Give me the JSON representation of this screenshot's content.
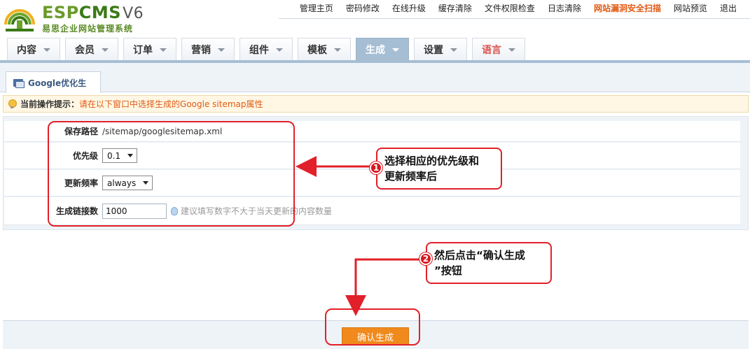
{
  "logo": {
    "brand_prefix": "ESP",
    "brand_suffix": "CMS",
    "version": "V6",
    "subtitle": "易思企业网站管理系统"
  },
  "topnav": [
    "管理主页",
    "密码修改",
    "在线升级",
    "缓存清除",
    "文件权限检查",
    "日志清除",
    "网站漏洞安全扫描",
    "网站预览",
    "退出"
  ],
  "mainnav": [
    "内容",
    "会员",
    "订单",
    "营销",
    "组件",
    "模板",
    "生成",
    "设置",
    "语言"
  ],
  "subtab": "Google优化生",
  "tip": {
    "label": "当前操作提示：",
    "message": "请在以下窗口中选择生成的Google sitemap属性"
  },
  "form": {
    "path_label": "保存路径",
    "path_value": "/sitemap/googlesitemap.xml",
    "priority_label": "优先级",
    "priority_value": "0.1",
    "freq_label": "更新频率",
    "freq_value": "always",
    "links_label": "生成链接数",
    "links_value": "1000",
    "links_hint": "建议填写数字不大于当天更新的内容数量"
  },
  "confirm_button": "确认生成",
  "annotations": {
    "step1_num": "1",
    "step1_line1": "选择相应的优先级和",
    "step1_line2": "更新频率后",
    "step2_num": "2",
    "step2_line1": "然后点击“确认生成",
    "step2_line2": "”按钮"
  },
  "colors": {
    "accent_orange": "#f08a1c",
    "nav_active": "#a6bed3",
    "annotation_red": "#e2202a",
    "warning_text": "#e05a14"
  }
}
